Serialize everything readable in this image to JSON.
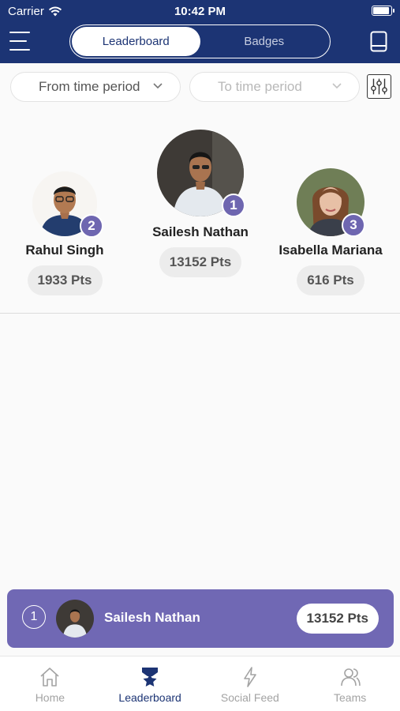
{
  "status": {
    "carrier": "Carrier",
    "time": "10:42 PM",
    "battery_level": 0.9
  },
  "header": {
    "tabs": [
      {
        "label": "Leaderboard",
        "active": true
      },
      {
        "label": "Badges",
        "active": false
      }
    ]
  },
  "filters": {
    "from_placeholder": "From time period",
    "to_placeholder": "To time period"
  },
  "podium": {
    "first": {
      "rank": "1",
      "name": "Sailesh Nathan",
      "points": "13152 Pts"
    },
    "second": {
      "rank": "2",
      "name": "Rahul Singh",
      "points": "1933 Pts"
    },
    "third": {
      "rank": "3",
      "name": "Isabella Mariana",
      "points": "616 Pts"
    }
  },
  "my_rank": {
    "rank": "1",
    "name": "Sailesh Nathan",
    "points": "13152 Pts"
  },
  "tabbar": {
    "items": [
      {
        "label": "Home",
        "icon": "home-icon"
      },
      {
        "label": "Leaderboard",
        "icon": "leaderboard-icon"
      },
      {
        "label": "Social Feed",
        "icon": "lightning-icon"
      },
      {
        "label": "Teams",
        "icon": "teams-icon"
      }
    ]
  },
  "colors": {
    "primary": "#1c3474",
    "accent": "#6e66b0",
    "bar": "#7068b4"
  }
}
